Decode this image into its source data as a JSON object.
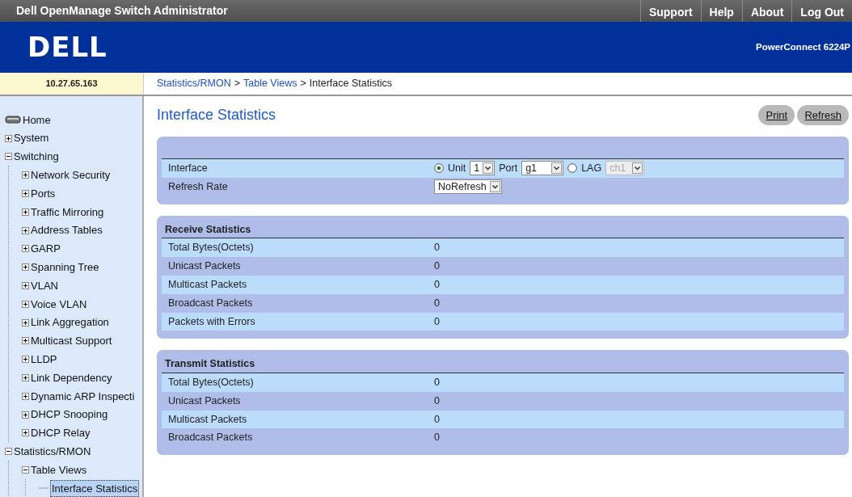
{
  "title_bar": {
    "title": "Dell OpenManage Switch Administrator",
    "links": [
      "Support",
      "Help",
      "About",
      "Log Out"
    ]
  },
  "header": {
    "logo": "DELL",
    "product": "PowerConnect 6224P"
  },
  "address": "10.27.65.163",
  "breadcrumb": {
    "separator": ">",
    "items": [
      "Statistics/RMON",
      "Table Views",
      "Interface Statistics"
    ]
  },
  "sidebar": {
    "items": [
      {
        "label": "Home",
        "kind": "home"
      },
      {
        "label": "System",
        "kind": "folder",
        "expanded": false
      },
      {
        "label": "Switching",
        "kind": "folder",
        "expanded": true,
        "children": [
          {
            "label": "Network Security",
            "kind": "folder",
            "expanded": false
          },
          {
            "label": "Ports",
            "kind": "folder",
            "expanded": false
          },
          {
            "label": "Traffic Mirroring",
            "kind": "folder",
            "expanded": false
          },
          {
            "label": "Address Tables",
            "kind": "folder",
            "expanded": false
          },
          {
            "label": "GARP",
            "kind": "folder",
            "expanded": false
          },
          {
            "label": "Spanning Tree",
            "kind": "folder",
            "expanded": false
          },
          {
            "label": "VLAN",
            "kind": "folder",
            "expanded": false
          },
          {
            "label": "Voice VLAN",
            "kind": "folder",
            "expanded": false
          },
          {
            "label": "Link Aggregation",
            "kind": "folder",
            "expanded": false
          },
          {
            "label": "Multicast Support",
            "kind": "folder",
            "expanded": false
          },
          {
            "label": "LLDP",
            "kind": "folder",
            "expanded": false
          },
          {
            "label": "Link Dependency",
            "kind": "folder",
            "expanded": false
          },
          {
            "label": "Dynamic ARP Inspecti",
            "kind": "folder",
            "expanded": false
          },
          {
            "label": "DHCP Snooping",
            "kind": "folder",
            "expanded": false
          },
          {
            "label": "DHCP Relay",
            "kind": "folder",
            "expanded": false
          }
        ]
      },
      {
        "label": "Statistics/RMON",
        "kind": "folder",
        "expanded": true,
        "children": [
          {
            "label": "Table Views",
            "kind": "folder",
            "expanded": true,
            "children": [
              {
                "label": "Interface Statistics",
                "kind": "page",
                "selected": true
              }
            ]
          }
        ]
      }
    ]
  },
  "page_title": "Interface Statistics",
  "buttons": [
    "Print",
    "Refresh"
  ],
  "settings": {
    "rows": [
      {
        "label": "Interface",
        "kind": "interface",
        "unit_label": "Unit",
        "unit_selected": true,
        "unit": "1",
        "port_label": "Port",
        "port": "g1",
        "lag_label": "LAG",
        "lag_selected": false,
        "lag": "ch1",
        "lag_disabled": true
      },
      {
        "label": "Refresh Rate",
        "kind": "select",
        "value": "NoRefresh"
      }
    ]
  },
  "sections": [
    {
      "title": "Receive Statistics",
      "rows": [
        {
          "label": "Total Bytes(Octets)",
          "value": "0"
        },
        {
          "label": "Unicast Packets",
          "value": "0"
        },
        {
          "label": "Multicast Packets",
          "value": "0"
        },
        {
          "label": "Broadcast Packets",
          "value": "0"
        },
        {
          "label": "Packets with Errors",
          "value": "0"
        }
      ]
    },
    {
      "title": "Transmit Statistics",
      "rows": [
        {
          "label": "Total Bytes(Octets)",
          "value": "0"
        },
        {
          "label": "Unicast Packets",
          "value": "0"
        },
        {
          "label": "Multicast Packets",
          "value": "0"
        },
        {
          "label": "Broadcast Packets",
          "value": "0"
        }
      ]
    }
  ]
}
